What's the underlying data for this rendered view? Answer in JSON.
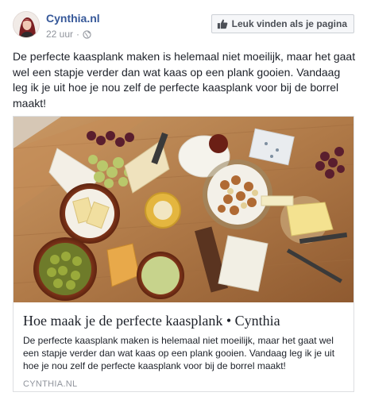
{
  "post": {
    "page_name": "Cynthia.nl",
    "timestamp": "22 uur",
    "separator": "·",
    "privacy_icon": "globe-icon",
    "like_button": {
      "icon": "thumbs-up-icon",
      "label": "Leuk vinden als je pagina"
    },
    "message": "De perfecte kaasplank maken is helemaal niet moeilijk, maar het gaat wel een stapje verder dan wat kaas op een plank gooien. Vandaag leg ik je uit hoe je nou zelf de perfecte kaasplank voor bij de borrel maakt!"
  },
  "link_card": {
    "title": "Hoe maak je de perfecte kaasplank • Cynthia",
    "description": "De perfecte kaasplank maken is helemaal niet moeilijk, maar het gaat wel een stapje verder dan wat kaas op een plank gooien. Vandaag leg ik je uit hoe je nou zelf de perfecte kaasplank voor bij de borrel maakt!",
    "domain": "CYNTHIA.NL"
  },
  "colors": {
    "page_name": "#365899",
    "meta_gray": "#90949c",
    "text": "#1d2129",
    "border": "#dddfe2"
  }
}
